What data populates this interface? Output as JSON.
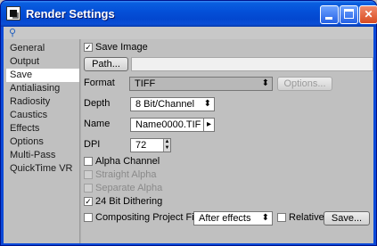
{
  "window": {
    "title": "Render Settings"
  },
  "sidebar": {
    "items": [
      {
        "label": "General"
      },
      {
        "label": "Output"
      },
      {
        "label": "Save"
      },
      {
        "label": "Antialiasing"
      },
      {
        "label": "Radiosity"
      },
      {
        "label": "Caustics"
      },
      {
        "label": "Effects"
      },
      {
        "label": "Options"
      },
      {
        "label": "Multi-Pass"
      },
      {
        "label": "QuickTime VR"
      }
    ],
    "selected": "Save"
  },
  "save": {
    "save_image": {
      "label": "Save Image",
      "checked": true
    },
    "path_button": "Path...",
    "path_value": "",
    "format": {
      "label": "Format",
      "value": "TIFF"
    },
    "options_button": "Options...",
    "depth": {
      "label": "Depth",
      "value": "8 Bit/Channel"
    },
    "name": {
      "label": "Name",
      "value": "Name0000.TIF"
    },
    "dpi": {
      "label": "DPI",
      "value": "72"
    },
    "alpha_channel": {
      "label": "Alpha Channel",
      "checked": false
    },
    "straight_alpha": {
      "label": "Straight Alpha",
      "checked": false
    },
    "separate_alpha": {
      "label": "Separate Alpha",
      "checked": false
    },
    "dithering": {
      "label": "24 Bit Dithering",
      "checked": true
    },
    "compositing": {
      "label": "Compositing Project File",
      "checked": false,
      "value": "After effects"
    },
    "relative": {
      "label": "Relative",
      "checked": false
    },
    "save_button": "Save..."
  }
}
